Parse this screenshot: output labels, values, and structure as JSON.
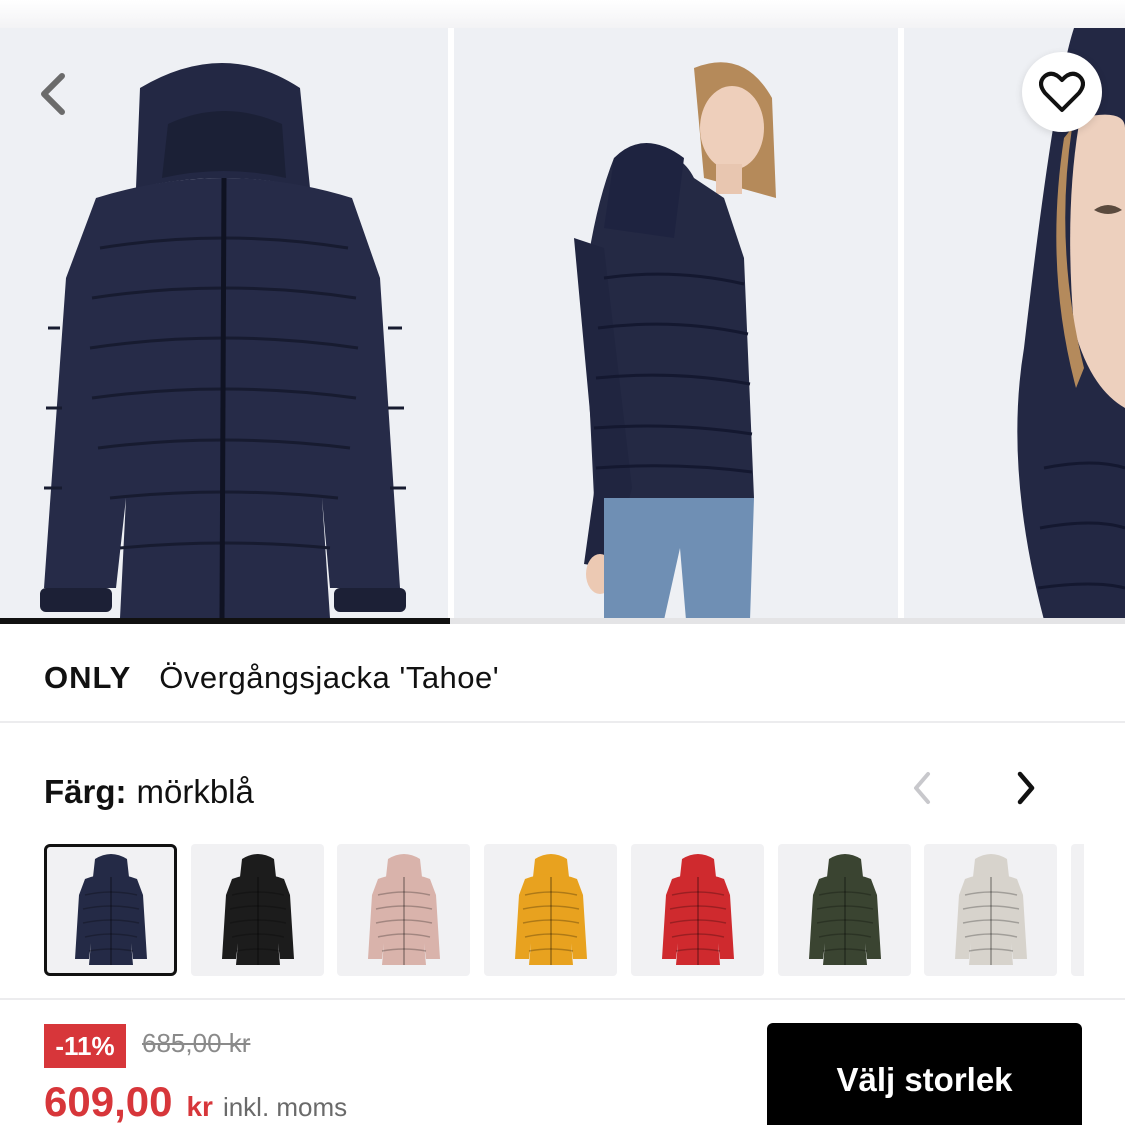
{
  "gallery": {
    "prev_icon": "chevron-left-icon",
    "favorite_icon": "heart-outline-icon",
    "image_count": 3,
    "progress": 0.4,
    "images": [
      {
        "subject": "product-front",
        "jacket_color": "#232844"
      },
      {
        "subject": "model-side",
        "jacket_color": "#232844"
      },
      {
        "subject": "model-closeup",
        "jacket_color": "#232844"
      }
    ]
  },
  "product": {
    "brand": "ONLY",
    "name": "Övergångsjacka 'Tahoe'"
  },
  "color": {
    "label": "Färg:",
    "selected": "mörkblå",
    "prev_icon": "chevron-left-icon",
    "next_icon": "chevron-right-icon",
    "swatches": [
      {
        "name": "mörkblå",
        "hex": "#242a46",
        "selected": true
      },
      {
        "name": "svart",
        "hex": "#1c1c1c",
        "selected": false
      },
      {
        "name": "rosa",
        "hex": "#d9b3ab",
        "selected": false
      },
      {
        "name": "gul",
        "hex": "#e8a21f",
        "selected": false
      },
      {
        "name": "röd",
        "hex": "#cf2a2e",
        "selected": false
      },
      {
        "name": "mörkgrön",
        "hex": "#3a4431",
        "selected": false
      },
      {
        "name": "beige",
        "hex": "#d7d3cc",
        "selected": false
      }
    ]
  },
  "price": {
    "discount": "-11%",
    "original": "685,00 kr",
    "current": "609,00",
    "currency": "kr",
    "vat_note": "inkl. moms"
  },
  "cta": {
    "label": "Välj storlek"
  },
  "colors": {
    "accent": "#d7363a",
    "button_bg": "#000000",
    "text": "#111111"
  }
}
